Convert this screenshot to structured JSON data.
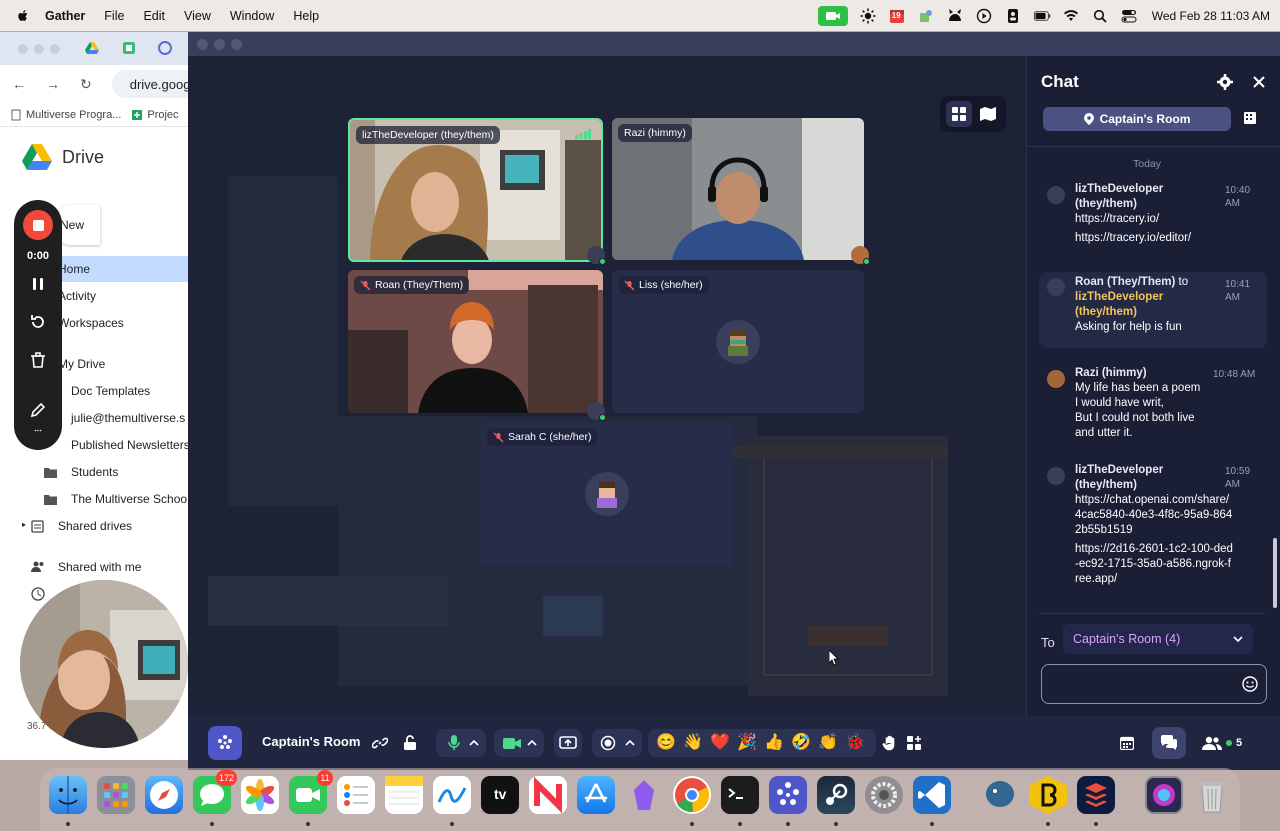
{
  "menubar": {
    "app_name": "Gather",
    "menus": [
      "File",
      "Edit",
      "View",
      "Window",
      "Help"
    ],
    "clock": "Wed Feb 28  11:03 AM",
    "calendar_badge": "19"
  },
  "chrome": {
    "url": "drive.goog",
    "bookmarks": [
      "Multiverse Progra...",
      "Projec"
    ],
    "drive_title": "Drive",
    "new_label": "New",
    "nav": {
      "home": "Home",
      "activity": "Activity",
      "workspaces": "Workspaces",
      "my_drive": "My Drive",
      "doc_templates": "Doc Templates",
      "julie": "julie@themultiverse.s",
      "published": "Published Newsletters",
      "students": "Students",
      "multiverse_school": "The Multiverse Schoo",
      "shared_drives": "Shared drives",
      "shared_with_me": "Shared with me"
    },
    "storage_fragment": "36.7"
  },
  "recorder": {
    "time": "0:00"
  },
  "participants": [
    {
      "name": "lizTheDeveloper (they/them)",
      "muted": false,
      "video": true
    },
    {
      "name": "Razi (himmy)",
      "muted": false,
      "video": true
    },
    {
      "name": "Roan (They/Them)",
      "muted": true,
      "video": true
    },
    {
      "name": "Liss (she/her)",
      "muted": true,
      "video": false
    },
    {
      "name": "Sarah C (she/her)",
      "muted": true,
      "video": false
    }
  ],
  "chat": {
    "title": "Chat",
    "room_button": "Captain's Room",
    "today": "Today",
    "messages": [
      {
        "sender": "lizTheDeveloper (they/them)",
        "time": "10:40 AM",
        "lines": [
          "https://tracery.io/",
          "https://tracery.io/editor/"
        ]
      },
      {
        "sender": "Roan (They/Them)",
        "to_word": "to",
        "recipient": "lizTheDeveloper (they/them)",
        "time": "10:41 AM",
        "lines": [
          "Asking for help is fun"
        ]
      },
      {
        "sender": "Razi (himmy)",
        "time": "10:48 AM",
        "lines": [
          "My life has been a poem",
          "I would have writ,",
          "But I could not both live",
          "and utter it."
        ]
      },
      {
        "sender": "lizTheDeveloper (they/them)",
        "time": "10:59 AM",
        "lines": [
          "https://chat.openai.com/share/4cac5840-40e3-4f8c-95a9-8642b55b1519",
          "https://2d16-2601-1c2-100-ded-ec92-1715-35a0-a586.ngrok-free.app/"
        ]
      }
    ],
    "to_label": "To",
    "to_value": "Captain's Room (4)"
  },
  "toolbar": {
    "room_name": "Captain's Room",
    "emojis": [
      "😊",
      "👋",
      "❤️",
      "🎉",
      "👍",
      "🤣",
      "👏",
      "🐞"
    ],
    "online_count": "5"
  },
  "dock": {
    "messages_badge": "172",
    "facetime_badge": "11",
    "tv_label": "tv"
  },
  "colors": {
    "accent": "#5ee6a2",
    "chat_room": "#4b5180",
    "recipient": "#f1c35a",
    "to_value": "#d8a3ff"
  }
}
